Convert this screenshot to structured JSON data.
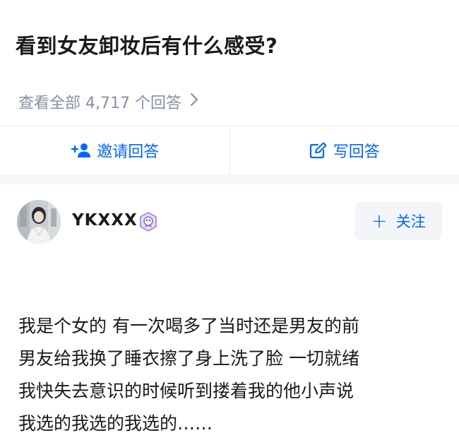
{
  "question": {
    "title": "看到女友卸妆后有什么感受?",
    "view_all": "查看全部 4,717 个回答",
    "chevron": "›"
  },
  "actions": {
    "invite_label": "邀请回答",
    "write_label": "写回答"
  },
  "author": {
    "name": "YKXXX",
    "follow_label": "关注",
    "follow_plus": "+"
  },
  "answer": {
    "lines": [
      "我是个女的 有一次喝多了当时还是男友的前",
      "男友给我换了睡衣擦了身上洗了脸 一切就绪",
      "我快失去意识的时候听到搂着我的他小声说",
      "我选的我选的我选的……"
    ]
  },
  "colors": {
    "accent": "#0066ff",
    "muted": "#8590a6",
    "divider": "#f6f6f6"
  },
  "icons": [
    "add-user-icon",
    "edit-icon",
    "chevron-right-icon",
    "plus-icon",
    "author-badge-icon"
  ]
}
